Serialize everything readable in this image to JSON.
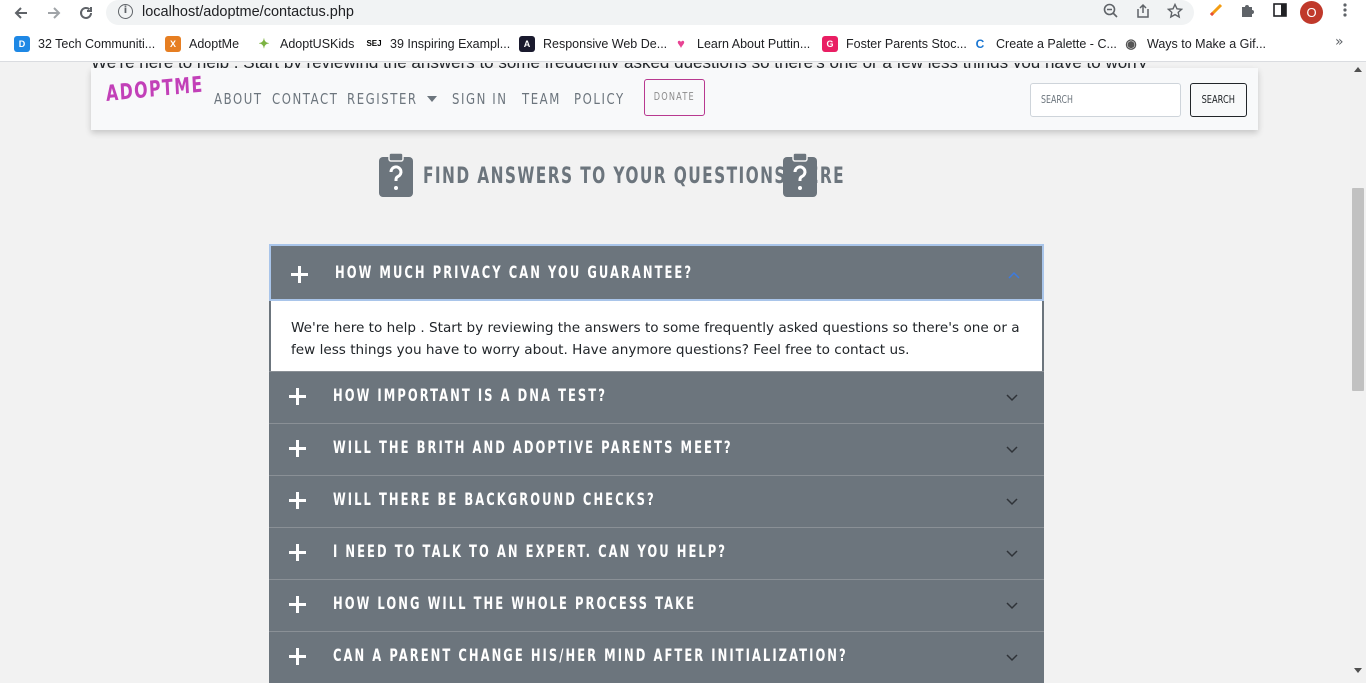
{
  "browser": {
    "url": "localhost/adoptme/contactus.php",
    "avatar_letter": "O",
    "bookmarks": [
      {
        "label": "32 Tech Communiti...",
        "color": "#1e88e5",
        "glyph": "D"
      },
      {
        "label": "AdoptMe",
        "color": "#e67e22",
        "glyph": "X"
      },
      {
        "label": "AdoptUSKids",
        "color": "#7cb342",
        "glyph": "✦"
      },
      {
        "label": "39 Inspiring Exampl...",
        "color": "#000000",
        "glyph": "SEJ"
      },
      {
        "label": "Responsive Web De...",
        "color": "#1a1a2e",
        "glyph": "A"
      },
      {
        "label": "Learn About Puttin...",
        "color": "#e84393",
        "glyph": "♥"
      },
      {
        "label": "Foster Parents Stoc...",
        "color": "#e91e63",
        "glyph": "G"
      },
      {
        "label": "Create a Palette - C...",
        "color": "#1976d2",
        "glyph": "C"
      },
      {
        "label": "Ways to Make a Gif...",
        "color": "#555555",
        "glyph": "◉"
      }
    ]
  },
  "page": {
    "behind_text": "We're here to help . Start by reviewing the answers to some frequently asked questions so there's one or a few less things you have to worry",
    "brand": "ADOPTME",
    "brand_color": "#c240b8",
    "nav": [
      "ABOUT",
      "CONTACT",
      "REGISTER",
      "SIGN IN",
      "TEAM",
      "POLICY"
    ],
    "donate_label": "DONATE",
    "search_placeholder": "SEARCH",
    "search_button": "SEARCH",
    "heading": "FIND ANSWERS TO YOUR QUESTIONS HERE"
  },
  "faq": [
    {
      "question": "HOW MUCH PRIVACY CAN YOU GUARANTEE?",
      "open": true,
      "answer": "We're here to help . Start by reviewing the answers to some frequently asked questions so there's one or a few less things you have to worry about. Have anymore questions? Feel free to contact us."
    },
    {
      "question": "HOW IMPORTANT IS A DNA TEST?",
      "open": false
    },
    {
      "question": "WILL THE BRITH AND ADOPTIVE PARENTS MEET?",
      "open": false
    },
    {
      "question": "WILL THERE BE BACKGROUND CHECKS?",
      "open": false
    },
    {
      "question": "I NEED TO TALK TO AN EXPERT. CAN YOU HELP?",
      "open": false
    },
    {
      "question": "HOW LONG WILL THE WHOLE PROCESS TAKE",
      "open": false
    },
    {
      "question": "CAN A PARENT CHANGE HIS/HER MIND AFTER INITIALIZATION?",
      "open": false
    }
  ]
}
